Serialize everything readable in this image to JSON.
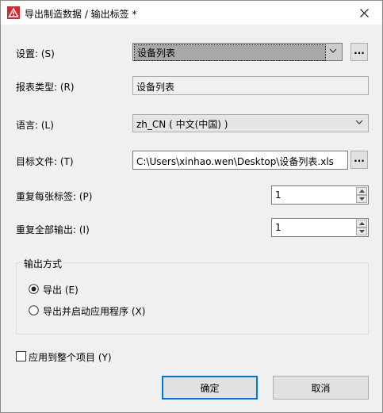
{
  "window": {
    "title": "导出制造数据 / 输出标签 *"
  },
  "form": {
    "settings": {
      "label": "设置: (S)",
      "value": "设备列表",
      "more": "..."
    },
    "report_type": {
      "label": "报表类型: (R)",
      "value": "设备列表"
    },
    "language": {
      "label": "语言: (L)",
      "value": "zh_CN ( 中文(中国) )"
    },
    "target_file": {
      "label": "目标文件: (T)",
      "value": "C:\\Users\\xinhao.wen\\Desktop\\设备列表.xls",
      "more": "..."
    },
    "repeat_each": {
      "label": "重复每张标签: (P)",
      "value": "1"
    },
    "repeat_all": {
      "label": "重复全部输出: (I)",
      "value": "1"
    }
  },
  "output_mode": {
    "title": "输出方式",
    "options": [
      {
        "label": "导出 (E)",
        "selected": true
      },
      {
        "label": "导出并启动应用程序 (X)",
        "selected": false
      }
    ]
  },
  "apply_project": {
    "label": "应用到整个项目 (Y)",
    "checked": false
  },
  "buttons": {
    "ok": "确定",
    "cancel": "取消"
  },
  "colors": {
    "accent": "#0078d7",
    "icon_red": "#d8262c"
  }
}
